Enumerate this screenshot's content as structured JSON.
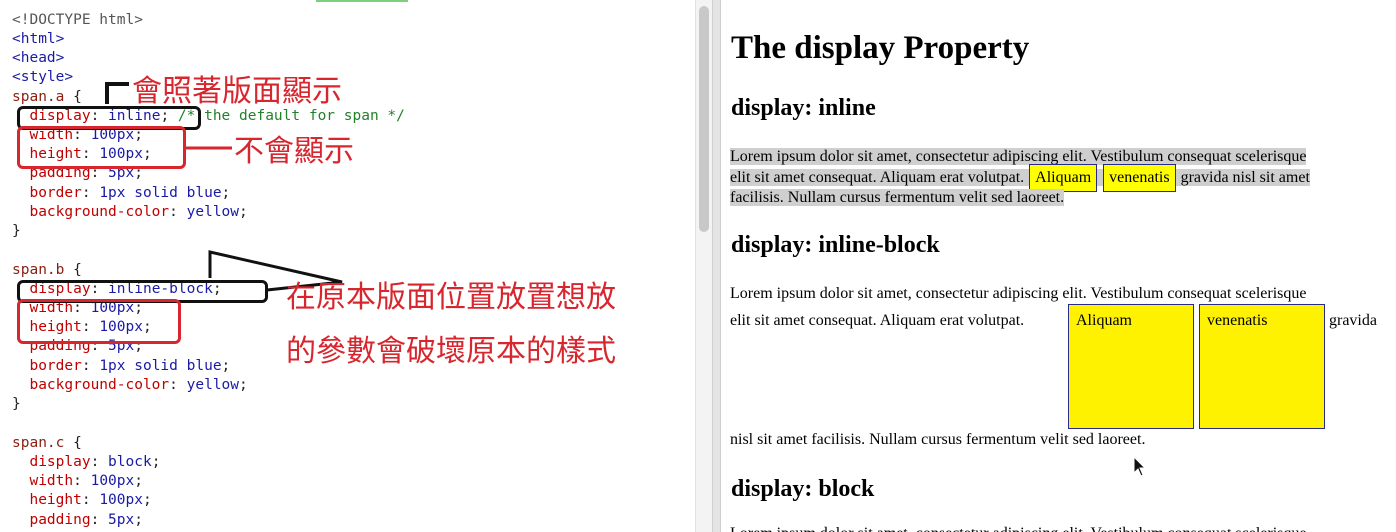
{
  "colors": {
    "annotation_red": "#d8262e",
    "annotation_black": "#111111",
    "highlight_yellow": "#fff200",
    "selection_gray": "#cfcfcf"
  },
  "code": {
    "l1": "<!DOCTYPE html>",
    "l2": "<html>",
    "l3": "<head>",
    "l4": "<style>",
    "a_sel": "span.a",
    "brace_open": "{",
    "brace_close": "}",
    "display": "display",
    "width": "width",
    "height": "height",
    "padding": "padding",
    "border": "border",
    "background": "background-color",
    "inline": "inline",
    "inline_block": "inline-block",
    "block": "block",
    "comment": "/* the default for span */",
    "v100": "100px",
    "v5": "5px",
    "border_val": "1px solid blue",
    "yellow": "yellow",
    "b_sel": "span.b",
    "c_sel": "span.c"
  },
  "annotations": {
    "shows_per_layout": "會照著版面顯示",
    "not_shown": "不會顯示",
    "breaks_line1": "在原本版面位置放置想放",
    "breaks_line2": "的參數會破壞原本的樣式"
  },
  "preview": {
    "title": "The display Property",
    "h_inline": "display: inline",
    "h_inline_block": "display: inline-block",
    "h_block": "display: block",
    "p1_line1": "Lorem ipsum dolor sit amet, consectetur adipiscing elit. Vestibulum consequat scelerisque",
    "p1_line2_a": "elit sit amet consequat. Aliquam erat volutpat.",
    "span1": "Aliquam",
    "span2": "venenatis",
    "p1_line2_b": "gravida nisl sit amet",
    "p1_line3": "facilisis. Nullam cursus fermentum velit sed laoreet.",
    "p2_line1": "Lorem ipsum dolor sit amet, consectetur adipiscing elit. Vestibulum consequat scelerisque",
    "p2_line2_a": "elit sit amet consequat. Aliquam erat volutpat.",
    "p2_line2_b": "gravida",
    "p2_line3": "nisl sit amet facilisis. Nullam cursus fermentum velit sed laoreet.",
    "p3_line1": "Lorem ipsum dolor sit amet, consectetur adipiscing elit. Vestibulum consequat scelerisque"
  }
}
